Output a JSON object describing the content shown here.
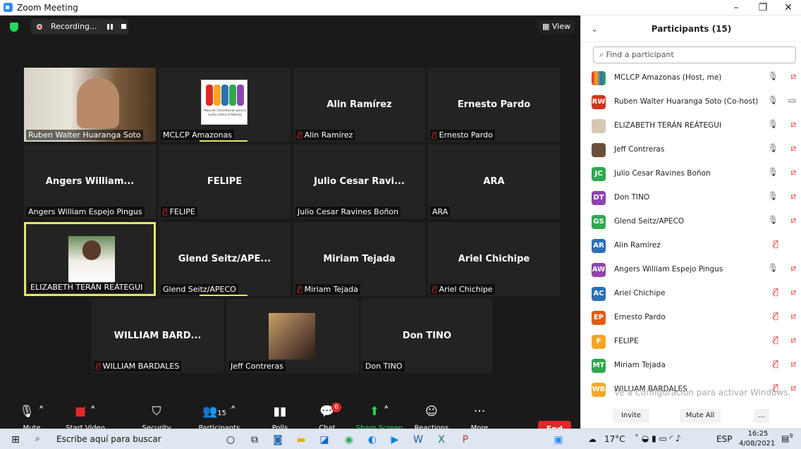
{
  "window": {
    "title": "Zoom Meeting",
    "minimize": "–",
    "restore": "❐",
    "close": "✕"
  },
  "topbar": {
    "recording": "Recording...",
    "view": "▦ View"
  },
  "tiles": [
    {
      "name": "",
      "label": "Ruben Walter Huaranga Soto",
      "muted": false
    },
    {
      "name": "",
      "label": "MCLCP Amazonas",
      "muted": false,
      "speaking": true
    },
    {
      "name": "Alin Ramírez",
      "label": "Alin Ramírez",
      "muted": true
    },
    {
      "name": "Ernesto Pardo",
      "label": "Ernesto Pardo",
      "muted": true
    },
    {
      "name": "Angers William...",
      "label": "Angers William Espejo Pingus",
      "muted": false
    },
    {
      "name": "FELIPE",
      "label": "FELIPE",
      "muted": true
    },
    {
      "name": "Julio Cesar Ravi...",
      "label": "Julio Cesar Ravines Boñon",
      "muted": false
    },
    {
      "name": "ARA",
      "label": "ARA",
      "muted": false
    },
    {
      "name": "",
      "label": "ELIZABETH TERÁN REÁTEGUI",
      "muted": false,
      "active": true
    },
    {
      "name": "Glend Seitz/APE...",
      "label": "Glend Seitz/APECO",
      "muted": false,
      "speaking": true
    },
    {
      "name": "Miriam Tejada",
      "label": "Miriam Tejada",
      "muted": true
    },
    {
      "name": "Ariel Chichipe",
      "label": "Ariel Chichipe",
      "muted": true
    },
    {
      "name": "WILLIAM BARD...",
      "label": "WILLIAM BARDALES",
      "muted": true
    },
    {
      "name": "",
      "label": "Jeff Contreras",
      "muted": false
    },
    {
      "name": "Don TINO",
      "label": "Don TINO",
      "muted": false
    }
  ],
  "logo_tile": {
    "caption": "Mesa de Concertación para la Lucha contra la Pobreza"
  },
  "toolbar": {
    "mute": "Mute",
    "start_video": "Start Video",
    "security": "Security",
    "participants": "Participants",
    "participants_count": "15",
    "polls": "Polls",
    "chat": "Chat",
    "chat_badge": "6",
    "share": "Share Screen",
    "reactions": "Reactions",
    "more": "More",
    "end": "End"
  },
  "panel": {
    "title": "Participants (15)",
    "search_placeholder": "Find a participant",
    "participants": [
      {
        "initials": "",
        "name": "MCLCP Amazonas (Host, me)",
        "color": "#ffffff",
        "mic_muted": false,
        "cam_muted": true
      },
      {
        "initials": "RW",
        "name": "Ruben Walter Huaranga Soto (Co-host)",
        "color": "#d0361f",
        "mic_muted": false,
        "cam_muted": false
      },
      {
        "initials": "",
        "name": "ELIZABETH TERÁN REÁTEGUI",
        "color": "#d8c7b5",
        "mic_muted": false,
        "cam_muted": true
      },
      {
        "initials": "",
        "name": "Jeff Contreras",
        "color": "#6b4e3a",
        "mic_muted": false,
        "cam_muted": true
      },
      {
        "initials": "JC",
        "name": "Julio Cesar Ravines Boñon",
        "color": "#2fa84f",
        "mic_muted": false,
        "cam_muted": true
      },
      {
        "initials": "DT",
        "name": "Don TINO",
        "color": "#8e44ad",
        "mic_muted": false,
        "cam_muted": true
      },
      {
        "initials": "GS",
        "name": "Glend Seitz/APECO",
        "color": "#2fa84f",
        "mic_muted": false,
        "cam_muted": true
      },
      {
        "initials": "AR",
        "name": "Alin Ramírez",
        "color": "#2c6fb5",
        "mic_muted": true,
        "cam_muted": null
      },
      {
        "initials": "AW",
        "name": "Angers William Espejo Pingus",
        "color": "#8e44ad",
        "mic_muted": false,
        "cam_muted": true
      },
      {
        "initials": "AC",
        "name": "Ariel Chichipe",
        "color": "#2c6fb5",
        "mic_muted": true,
        "cam_muted": true
      },
      {
        "initials": "EP",
        "name": "Ernesto Pardo",
        "color": "#e05d10",
        "mic_muted": true,
        "cam_muted": true
      },
      {
        "initials": "F",
        "name": "FELIPE",
        "color": "#f5a623",
        "mic_muted": true,
        "cam_muted": true
      },
      {
        "initials": "MT",
        "name": "Miriam Tejada",
        "color": "#2fa84f",
        "mic_muted": true,
        "cam_muted": true
      },
      {
        "initials": "WB",
        "name": "WILLIAM BARDALES",
        "color": "#f5a623",
        "mic_muted": true,
        "cam_muted": true
      }
    ],
    "invite": "Invite",
    "mute_all": "Mute All",
    "more": "...",
    "watermark": "Ve a Configuración para activar Windows."
  },
  "taskbar": {
    "search_placeholder": "Escribe aquí para buscar",
    "weather": "17°C",
    "lang": "ESP",
    "time": "16:25",
    "date": "4/08/2021",
    "notif": "9"
  }
}
